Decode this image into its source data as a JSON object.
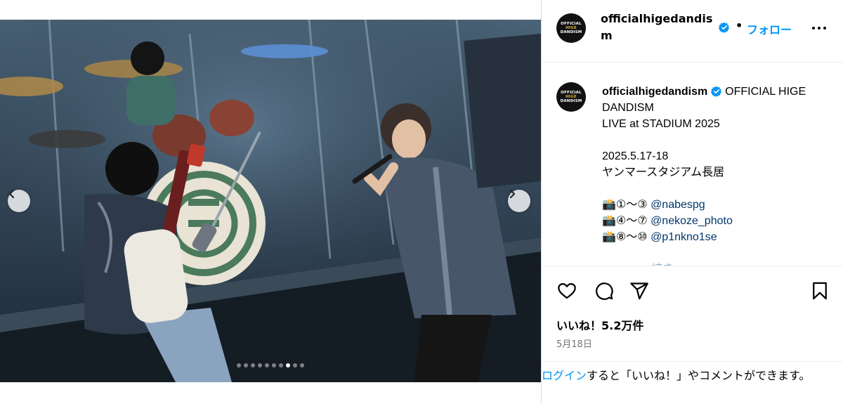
{
  "post": {
    "username": "officialhigedandism",
    "follow_label": "フォロー",
    "separator": "•",
    "avatar": {
      "line1": "OFFICIAL",
      "line2": "HIGE",
      "line3": "DANDISM"
    }
  },
  "caption": {
    "username": "officialhigedandism",
    "title_line1": "OFFICIAL HIGE DANDISM",
    "title_line2": "LIVE at STADIUM 2025",
    "date_line": "2025.5.17-18",
    "venue_line": "ヤンマースタジアム長居",
    "credits": [
      {
        "prefix": "📸①〜③ ",
        "handle": "@nabespg"
      },
      {
        "prefix": "📸④〜⑦ ",
        "handle": "@nekoze_photo"
      },
      {
        "prefix": "📸⑧〜⑩ ",
        "handle": "@p1nkno1se"
      }
    ],
    "faded_more": "続き"
  },
  "engagement": {
    "likes": "いいね！5.2万件",
    "date": "5月18日"
  },
  "login": {
    "link": "ログイン",
    "rest": "すると「いいね！」やコメントができます。"
  },
  "carousel": {
    "total": 10,
    "active_index": 7
  },
  "icons": {
    "prev": "chevron-left-icon",
    "next": "chevron-right-icon",
    "like": "heart-icon",
    "comment": "comment-icon",
    "share": "share-icon",
    "save": "bookmark-icon",
    "verified": "verified-badge-icon",
    "more": "more-options-icon"
  },
  "colors": {
    "link": "#0095f6",
    "mention": "#00376b",
    "verified": "#0095f6",
    "meta": "#737373"
  }
}
